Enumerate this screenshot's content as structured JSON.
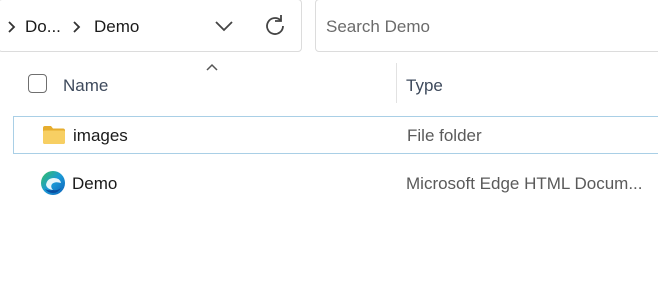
{
  "breadcrumb": {
    "items": [
      {
        "label": "Do..."
      },
      {
        "label": "Demo"
      }
    ]
  },
  "search": {
    "placeholder": "Search Demo"
  },
  "columns": {
    "name": "Name",
    "type": "Type"
  },
  "rows": [
    {
      "name": "images",
      "type": "File folder",
      "icon": "folder-icon",
      "selected": true
    },
    {
      "name": "Demo",
      "type": "Microsoft Edge HTML Docum...",
      "icon": "edge-icon",
      "selected": false
    }
  ],
  "colors": {
    "selection_border": "#a9cfe6",
    "folder": "#f4c85a",
    "edge_blue": "#0c6fc9",
    "edge_green": "#35c15d"
  }
}
